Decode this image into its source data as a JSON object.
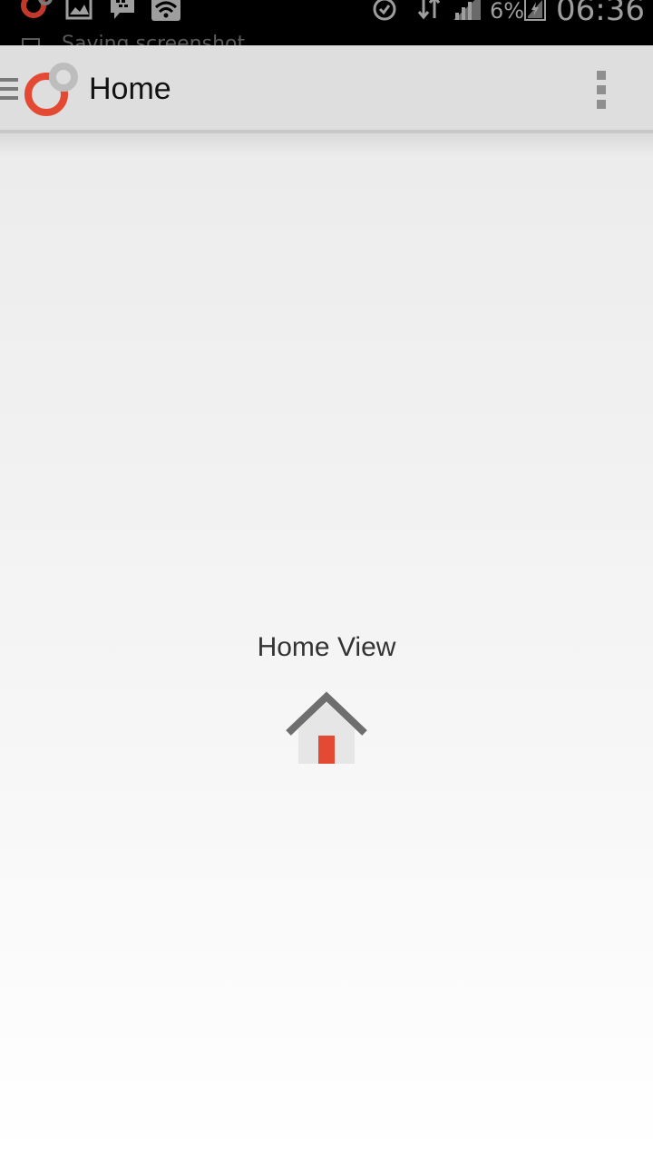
{
  "status_bar": {
    "battery_percent": "6%",
    "time": "06:36",
    "notification_peek": "Saving screenshot...",
    "icons": [
      "app-notification-icon",
      "gallery-icon",
      "bbm-icon",
      "wifi-icon",
      "alarm-icon",
      "data-transfer-icon",
      "signal-icon",
      "battery-icon"
    ]
  },
  "action_bar": {
    "title": "Home",
    "icons": [
      "drawer-menu-icon",
      "app-logo-icon",
      "overflow-menu-icon"
    ]
  },
  "content": {
    "title": "Home View",
    "icon": "home-icon"
  },
  "colors": {
    "accent": "#e44a33",
    "action_bar_bg": "#dedede",
    "icon_gray": "#6e6e6e"
  }
}
